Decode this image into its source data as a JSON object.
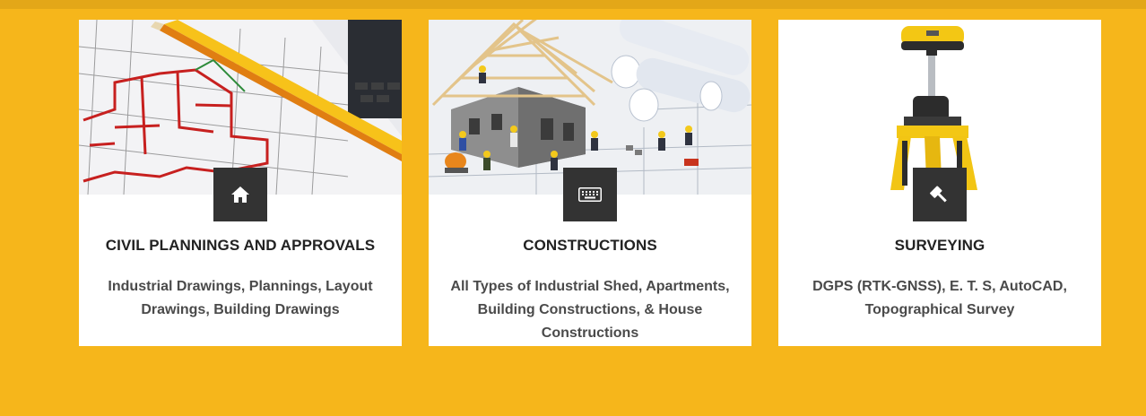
{
  "services": [
    {
      "title": "CIVIL PLANNINGS AND APPROVALS",
      "description": "Industrial Drawings, Plannings, Layout Drawings, Building Drawings",
      "icon": "home-icon",
      "image": "blueprint-with-pencil"
    },
    {
      "title": "CONSTRUCTIONS",
      "description": "All Types of Industrial Shed, Apartments, Building Constructions, & House Constructions",
      "icon": "keyboard-icon",
      "image": "house-construction-on-blueprints"
    },
    {
      "title": "SURVEYING",
      "description": "DGPS (RTK-GNSS), E. T. S, AutoCAD, Topographical Survey",
      "icon": "gavel-icon",
      "image": "gnss-receiver-on-tripod"
    }
  ],
  "colors": {
    "background": "#F6B61B",
    "card": "#FFFFFF",
    "icon_box": "#333333",
    "title": "#222222",
    "text": "#4A4A4A"
  }
}
